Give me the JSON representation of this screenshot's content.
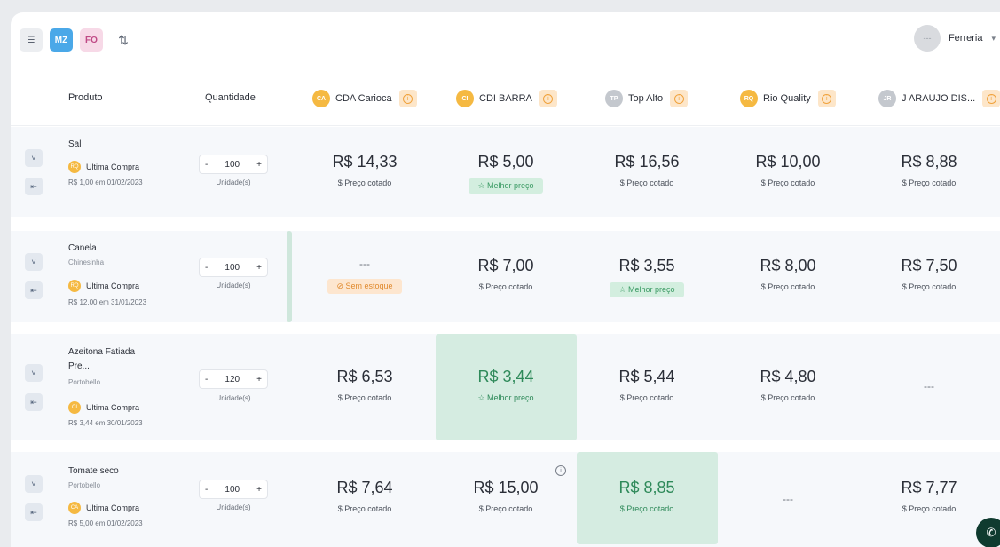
{
  "toolbar": {
    "collapse_icon": "list-indent-icon",
    "tag_mz": "MZ",
    "tag_fo": "FO",
    "sort_icon": "sort-icon",
    "user_avatar_text": "---",
    "user_name": "Ferreria",
    "user_caret": "▾"
  },
  "header": {
    "product": "Produto",
    "quantity": "Quantidade",
    "suppliers": [
      {
        "initials": "CA",
        "name": "CDA Carioca",
        "color": "#f5b942"
      },
      {
        "initials": "CI",
        "name": "CDI BARRA",
        "color": "#f5b942"
      },
      {
        "initials": "TP",
        "name": "Top Alto",
        "color": "#c4c8ce"
      },
      {
        "initials": "RQ",
        "name": "Rio Quality",
        "color": "#f5b942"
      },
      {
        "initials": "JR",
        "name": "J ARAUJO DIS...",
        "color": "#c4c8ce"
      }
    ],
    "info_glyph": "i"
  },
  "rows": [
    {
      "name": "Sal",
      "brand": "",
      "last_badge": "RQ",
      "last_label": "Ultima Compra",
      "last_price": "R$ 1,00 em 01/02/2023",
      "qty": "100",
      "unit": "Unidade(s)",
      "prices": [
        {
          "value": "R$ 14,33",
          "sub": "$ Preço cotado"
        },
        {
          "value": "R$ 5,00",
          "sub": "☆ Melhor preço"
        },
        {
          "value": "R$ 16,56",
          "sub": "$ Preço cotado"
        },
        {
          "value": "R$ 10,00",
          "sub": "$ Preço cotado"
        },
        {
          "value": "R$ 8,88",
          "sub": "$ Preço cotado"
        }
      ]
    },
    {
      "name": "Canela",
      "brand": "Chinesinha",
      "last_badge": "RQ",
      "last_label": "Ultima Compra",
      "last_price": "R$ 12,00 em 31/01/2023",
      "qty": "100",
      "unit": "Unidade(s)",
      "prices": [
        {
          "value": "---",
          "sub": "Sem estoque"
        },
        {
          "value": "R$ 7,00",
          "sub": "$ Preço cotado"
        },
        {
          "value": "R$ 3,55",
          "sub": "☆ Melhor preço"
        },
        {
          "value": "R$ 8,00",
          "sub": "$ Preço cotado"
        },
        {
          "value": "R$ 7,50",
          "sub": "$ Preço cotado"
        }
      ]
    },
    {
      "name_line1": "Azeitona Fatiada",
      "name_line2": "Pre...",
      "brand": "Portobello",
      "last_badge": "CI",
      "last_label": "Ultima Compra",
      "last_price": "R$ 3,44 em 30/01/2023",
      "qty": "120",
      "unit": "Unidade(s)",
      "prices": [
        {
          "value": "R$ 6,53",
          "sub": "$ Preço cotado"
        },
        {
          "value": "R$ 3,44",
          "sub": "☆ Melhor preço"
        },
        {
          "value": "R$ 5,44",
          "sub": "$ Preço cotado"
        },
        {
          "value": "R$ 4,80",
          "sub": "$ Preço cotado"
        },
        {
          "value": "---",
          "sub": ""
        }
      ]
    },
    {
      "name": "Tomate seco",
      "brand": "Portobello",
      "last_badge": "CA",
      "last_label": "Ultima Compra",
      "last_price": "R$ 5,00 em 01/02/2023",
      "qty": "100",
      "unit": "Unidade(s)",
      "prices": [
        {
          "value": "R$ 7,64",
          "sub": "$ Preço cotado"
        },
        {
          "value": "R$ 15,00",
          "sub": "$ Preço cotado"
        },
        {
          "value": "R$ 8,85",
          "sub": "$ Preço cotado"
        },
        {
          "value": "---",
          "sub": ""
        },
        {
          "value": "R$ 7,77",
          "sub": "$ Preço cotado"
        }
      ]
    }
  ],
  "controls": {
    "expand_glyph": "˅",
    "detail_glyph": "⇤",
    "minus": "-",
    "plus": "+",
    "info_glyph": "i",
    "whatsapp_icon": "whatsapp-icon"
  }
}
